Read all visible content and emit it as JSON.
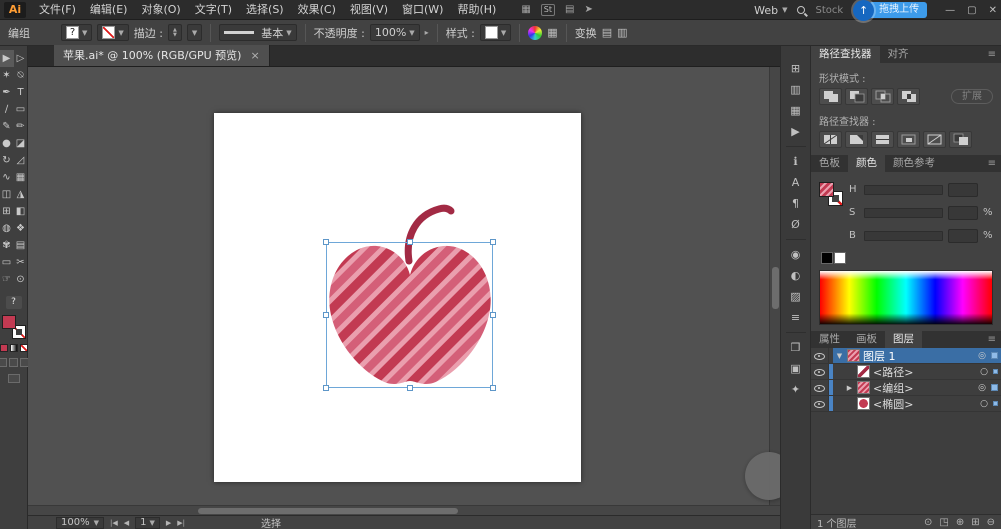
{
  "window": {
    "minimize": "—",
    "restore": "▢",
    "close": "✕"
  },
  "menubar": {
    "logo": "Ai",
    "menus": [
      "文件(F)",
      "编辑(E)",
      "对象(O)",
      "文字(T)",
      "选择(S)",
      "效果(C)",
      "视图(V)",
      "窗口(W)",
      "帮助(H)"
    ],
    "toolbar_icons": {
      "layout": "▦",
      "stock": "St",
      "columns": "▤",
      "share": "➤"
    },
    "workspace_label": "Web",
    "stock_text": "Stock",
    "upload": {
      "icon": "↑",
      "label": "拖拽上传"
    }
  },
  "controlbar": {
    "selection_type": "编组",
    "fill_value": "?",
    "stroke_label": "描边 :",
    "brush_name": "基本",
    "opacity_label": "不透明度 :",
    "opacity_value": "100%",
    "style_label": "样式 :",
    "transform_label": "变换"
  },
  "tab": {
    "title": "苹果.ai* @ 100% (RGB/GPU 预览)",
    "close": "×"
  },
  "tools": {
    "items": [
      "▶",
      "▷",
      "✶",
      "⍉",
      "✒",
      "T",
      "∕",
      "▭",
      "✎",
      "✏",
      "●",
      "◪",
      "↻",
      "◿",
      "∿",
      "▦",
      "◫",
      "◮",
      "⊞",
      "◧",
      "◍",
      "❖",
      "✾",
      "▤",
      "▭",
      "✂",
      "☞",
      "⊙"
    ],
    "help": "?"
  },
  "dock": {
    "icons": [
      "⊞",
      "▥",
      "▦",
      "▶",
      "ℹ",
      "A",
      "¶",
      "Ø",
      "◉",
      "◐",
      "▨",
      "≡",
      "❒",
      "▣",
      "✦"
    ]
  },
  "panels": {
    "menu_icon": "≡"
  },
  "pathfinder": {
    "tabs": [
      "路径查找器",
      "对齐"
    ],
    "shape_modes_label": "形状模式 :",
    "expand_button": "扩展",
    "pathfinder_label": "路径查找器 :"
  },
  "colorpanel": {
    "tabs": [
      "色板",
      "颜色",
      "颜色参考"
    ],
    "sliders": [
      {
        "label": "H",
        "unit": ""
      },
      {
        "label": "S",
        "unit": "%"
      },
      {
        "label": "B",
        "unit": "%"
      }
    ]
  },
  "layers": {
    "tabs": [
      "属性",
      "画板",
      "图层"
    ],
    "rows": [
      {
        "expander": "▼",
        "name": "图层 1",
        "target": "◎"
      },
      {
        "expander": "",
        "name": "<路径>",
        "target": "○"
      },
      {
        "expander": "▶",
        "name": "<编组>",
        "target": "◎"
      },
      {
        "expander": "",
        "name": "<椭圆>",
        "target": "○"
      }
    ],
    "footer": {
      "count": "1 个图层",
      "locate": "⊙",
      "clip": "◳",
      "new_sublayer": "⊕",
      "new_layer": "⊞",
      "delete": "⊖"
    }
  },
  "statusbar": {
    "zoom": "100%",
    "first": "|◀",
    "prev": "◀",
    "artboard": "1",
    "next": "▶",
    "last": "▶|",
    "tool": "选择"
  },
  "colors": {
    "selection_blue": "#6ea7d8",
    "layer_selected": "#3a6ea5",
    "apple_dark": "#c23a52",
    "apple_mid": "#d45f78",
    "apple_light": "#ea9fae",
    "stem": "#a22a44"
  }
}
